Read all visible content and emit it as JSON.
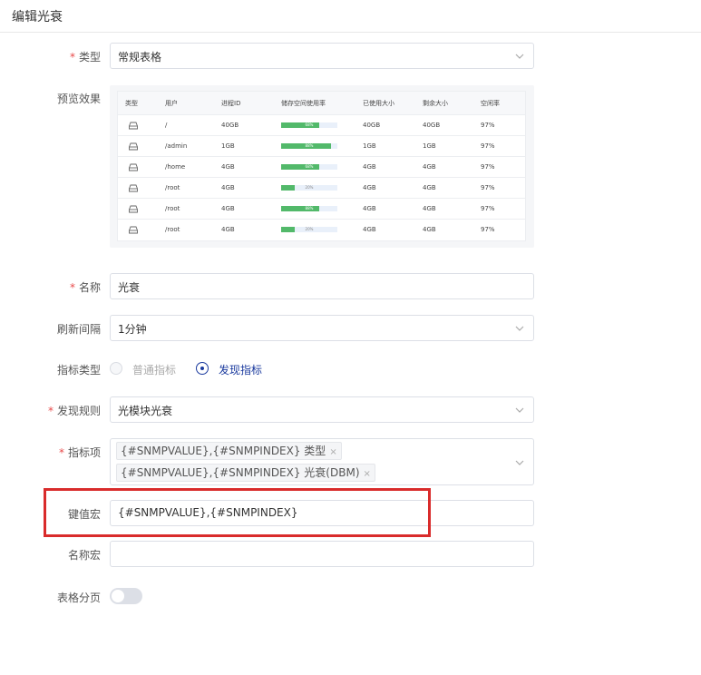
{
  "header": {
    "title": "编辑光衰"
  },
  "form": {
    "type": {
      "label": "类型",
      "value": "常规表格"
    },
    "preview": {
      "label": "预览效果",
      "columns": [
        "类型",
        "用户",
        "进程ID",
        "储存空间使用率",
        "已使用大小",
        "剩余大小",
        "空闲率"
      ],
      "rows": [
        {
          "user": "/",
          "pid": "40GB",
          "usage": 0.68,
          "usage_label": "68%",
          "used": "40GB",
          "free": "40GB",
          "idle": "97%"
        },
        {
          "user": "/admin",
          "pid": "1GB",
          "usage": 0.88,
          "usage_label": "88%",
          "used": "1GB",
          "free": "1GB",
          "idle": "97%"
        },
        {
          "user": "/home",
          "pid": "4GB",
          "usage": 0.68,
          "usage_label": "68%",
          "used": "4GB",
          "free": "4GB",
          "idle": "97%"
        },
        {
          "user": "/root",
          "pid": "4GB",
          "usage": 0.24,
          "usage_label": "20%",
          "used": "4GB",
          "free": "4GB",
          "idle": "97%"
        },
        {
          "user": "/root",
          "pid": "4GB",
          "usage": 0.68,
          "usage_label": "88%",
          "used": "4GB",
          "free": "4GB",
          "idle": "97%"
        },
        {
          "user": "/root",
          "pid": "4GB",
          "usage": 0.24,
          "usage_label": "20%",
          "used": "4GB",
          "free": "4GB",
          "idle": "97%"
        }
      ]
    },
    "name": {
      "label": "名称",
      "value": "光衰"
    },
    "refresh": {
      "label": "刷新间隔",
      "value": "1分钟"
    },
    "metric_type": {
      "label": "指标类型",
      "option_normal": "普通指标",
      "option_discover": "发现指标",
      "selected": "发现指标"
    },
    "discover_rule": {
      "label": "发现规则",
      "value": "光模块光衰"
    },
    "metric_items": {
      "label": "指标项",
      "tags": [
        "{#SNMPVALUE},{#SNMPINDEX} 类型",
        "{#SNMPVALUE},{#SNMPINDEX} 光衰(DBM)"
      ],
      "remove": "×"
    },
    "key_macro": {
      "label": "键值宏",
      "value": "{#SNMPVALUE},{#SNMPINDEX}"
    },
    "name_macro": {
      "label": "名称宏",
      "value": ""
    },
    "paging": {
      "label": "表格分页",
      "enabled": false
    }
  },
  "colors": {
    "accent": "#1a3a9e",
    "required": "#e84a4a",
    "highlight": "#d92b2b",
    "bar": "#52b96a"
  }
}
